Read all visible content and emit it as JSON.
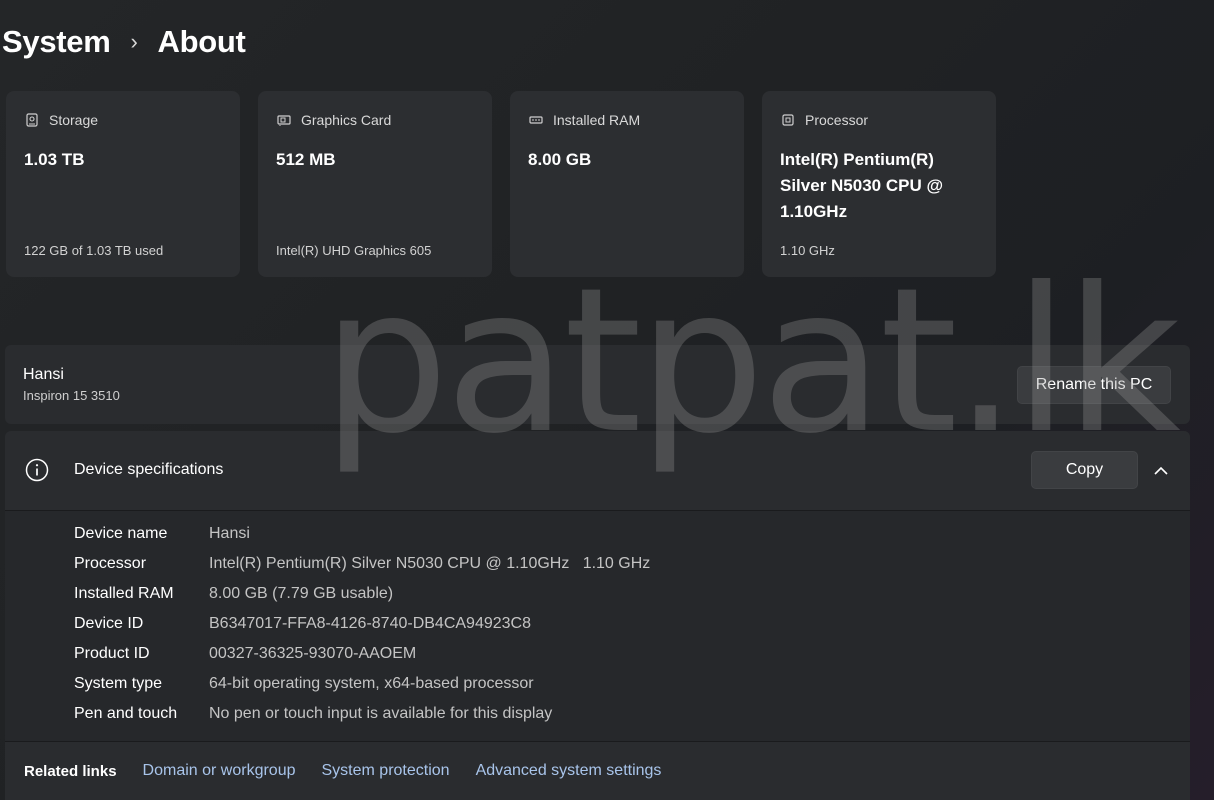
{
  "breadcrumb": {
    "parent": "System",
    "separator": "›",
    "current": "About"
  },
  "cards": [
    {
      "icon": "storage-icon",
      "title": "Storage",
      "value": "1.03 TB",
      "sub": "122 GB of 1.03 TB used"
    },
    {
      "icon": "graphics-card-icon",
      "title": "Graphics Card",
      "value": "512 MB",
      "sub": "Intel(R) UHD Graphics 605"
    },
    {
      "icon": "ram-icon",
      "title": "Installed RAM",
      "value": "8.00 GB",
      "sub": ""
    },
    {
      "icon": "processor-icon",
      "title": "Processor",
      "value": "Intel(R) Pentium(R) Silver N5030 CPU @ 1.10GHz",
      "sub": "1.10 GHz"
    }
  ],
  "pc": {
    "name": "Hansi",
    "model": "Inspiron 15 3510",
    "rename_label": "Rename this PC"
  },
  "specs": {
    "title": "Device specifications",
    "copy_label": "Copy",
    "rows": [
      {
        "label": "Device name",
        "value": "Hansi"
      },
      {
        "label": "Processor",
        "value": "Intel(R) Pentium(R) Silver N5030 CPU @ 1.10GHz   1.10 GHz"
      },
      {
        "label": "Installed RAM",
        "value": "8.00 GB (7.79 GB usable)"
      },
      {
        "label": "Device ID",
        "value": "B6347017-FFA8-4126-8740-DB4CA94923C8"
      },
      {
        "label": "Product ID",
        "value": "00327-36325-93070-AAOEM"
      },
      {
        "label": "System type",
        "value": "64-bit operating system, x64-based processor"
      },
      {
        "label": "Pen and touch",
        "value": "No pen or touch input is available for this display"
      }
    ]
  },
  "related": {
    "title": "Related links",
    "links": [
      "Domain or workgroup",
      "System protection",
      "Advanced system settings"
    ]
  },
  "watermark": "patpat.lk",
  "colors": {
    "card_bg": "#2c2e31",
    "panel_bg": "#2a2c2f",
    "link": "#a8c4ea"
  }
}
